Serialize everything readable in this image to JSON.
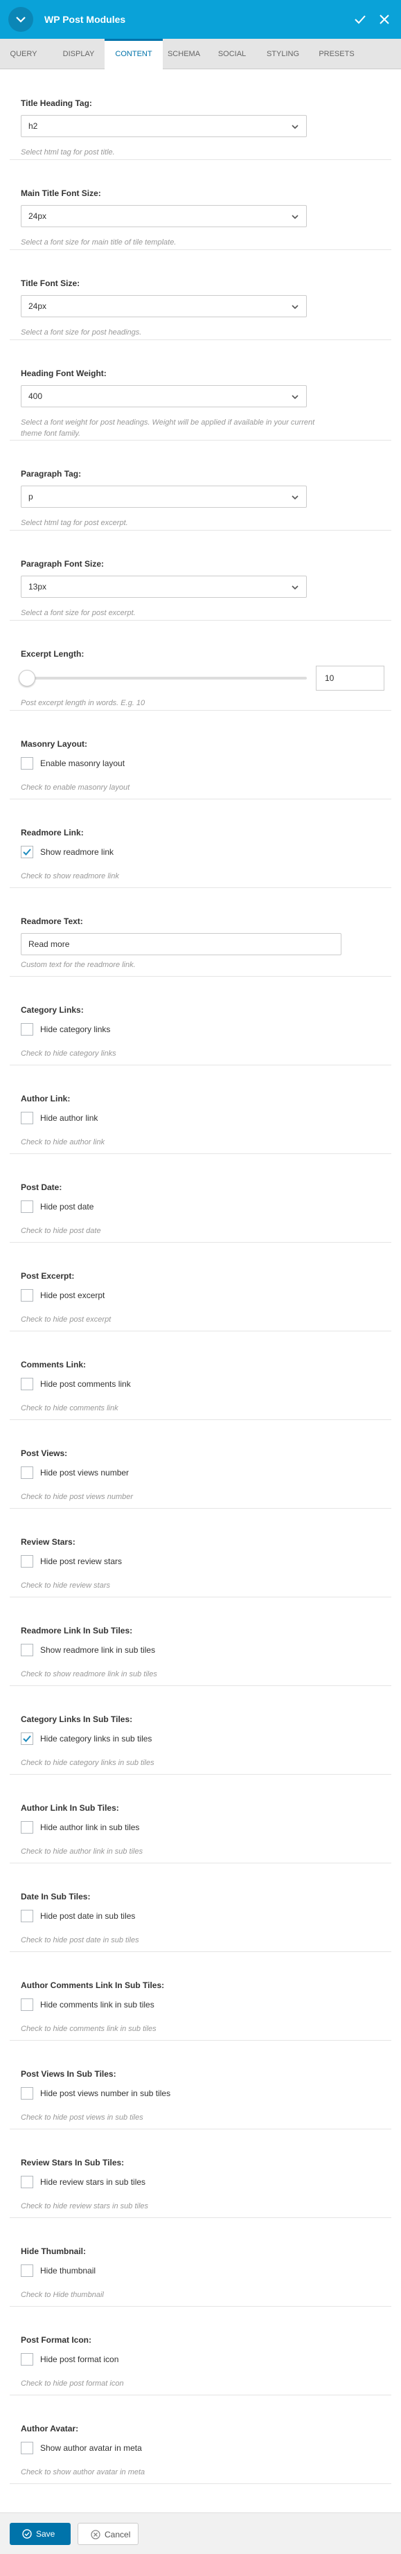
{
  "header": {
    "title": "WP Post Modules"
  },
  "tabs": [
    "QUERY",
    "DISPLAY",
    "CONTENT",
    "SCHEMA",
    "SOCIAL",
    "STYLING",
    "PRESETS"
  ],
  "active_tab": "CONTENT",
  "selects": [
    {
      "label": "Title Heading Tag:",
      "value": "h2",
      "hint": "Select html tag for post title."
    },
    {
      "label": "Main Title Font Size:",
      "value": "24px",
      "hint": "Select a font size for main title of tile template."
    },
    {
      "label": "Title Font Size:",
      "value": "24px",
      "hint": "Select a font size for post headings."
    },
    {
      "label": "Heading Font Weight:",
      "value": "400",
      "hint1": "Select a font weight for post headings. Weight will be applied if available in your current",
      "hint2": "theme font family."
    },
    {
      "label": "Paragraph Tag:",
      "value": "p",
      "hint": "Select html tag for post excerpt."
    },
    {
      "label": "Paragraph Font Size:",
      "value": "13px",
      "hint": "Select a font size for post excerpt."
    }
  ],
  "excerpt": {
    "label": "Excerpt Length:",
    "value": "10",
    "hint": "Post excerpt length in words. E.g. 10",
    "level": 0
  },
  "readmore_text": {
    "label": "Readmore Text:",
    "value": "Read more",
    "hint": "Custom text for the readmore link."
  },
  "checks": [
    {
      "label": "Masonry Layout:",
      "option": "Enable masonry layout",
      "hint": "Check to enable masonry layout",
      "checked": false
    },
    {
      "label": "Readmore Link:",
      "option": "Show readmore link",
      "hint": "Check to show readmore link",
      "checked": true
    },
    {
      "label": "Category Links:",
      "option": "Hide category links",
      "hint": "Check to hide category links",
      "checked": false
    },
    {
      "label": "Author Link:",
      "option": "Hide author link",
      "hint": "Check to hide author link",
      "checked": false
    },
    {
      "label": "Post Date:",
      "option": "Hide post date",
      "hint": "Check to hide post date",
      "checked": false
    },
    {
      "label": "Post Excerpt:",
      "option": "Hide post excerpt",
      "hint": "Check to hide post excerpt",
      "checked": false
    },
    {
      "label": "Comments Link:",
      "option": "Hide post comments link",
      "hint": "Check to hide comments link",
      "checked": false
    },
    {
      "label": "Post Views:",
      "option": "Hide post views number",
      "hint": "Check to hide post views number",
      "checked": false
    },
    {
      "label": "Review Stars:",
      "option": "Hide post review stars",
      "hint": "Check to hide review stars",
      "checked": false
    },
    {
      "label": "Readmore Link In Sub Tiles:",
      "option": "Show readmore link in sub tiles",
      "hint": "Check to show readmore link in sub tiles",
      "checked": false
    },
    {
      "label": "Category Links In Sub Tiles:",
      "option": "Hide category links in sub tiles",
      "hint": "Check to hide category links in sub tiles",
      "checked": true
    },
    {
      "label": "Author Link In Sub Tiles:",
      "option": "Hide author link in sub tiles",
      "hint": "Check to hide author link in sub tiles",
      "checked": false
    },
    {
      "label": "Date In Sub Tiles:",
      "option": "Hide post date in sub tiles",
      "hint": "Check to hide post date in sub tiles",
      "checked": false
    },
    {
      "label": "Author Comments Link In Sub Tiles:",
      "option": "Hide comments link in sub tiles",
      "hint": "Check to hide comments link in sub tiles",
      "checked": false
    },
    {
      "label": "Post Views In Sub Tiles:",
      "option": "Hide post views number in sub tiles",
      "hint": "Check to hide post views in sub tiles",
      "checked": false
    },
    {
      "label": "Review Stars In Sub Tiles:",
      "option": "Hide review stars in sub tiles",
      "hint": "Check to hide review stars in sub tiles",
      "checked": false
    },
    {
      "label": "Hide Thumbnail:",
      "option": "Hide thumbnail",
      "hint": "Check to Hide thumbnail",
      "checked": false
    },
    {
      "label": "Post Format Icon:",
      "option": "Hide post format icon",
      "hint": "Check to hide post format icon",
      "checked": false
    },
    {
      "label": "Author Avatar:",
      "option": "Show author avatar in meta",
      "hint": "Check to show author avatar in meta",
      "checked": false
    }
  ],
  "footer": {
    "save": "Save",
    "cancel": "Cancel"
  },
  "colors": {
    "accent": "#0aa2d8",
    "primary": "#0073aa"
  }
}
